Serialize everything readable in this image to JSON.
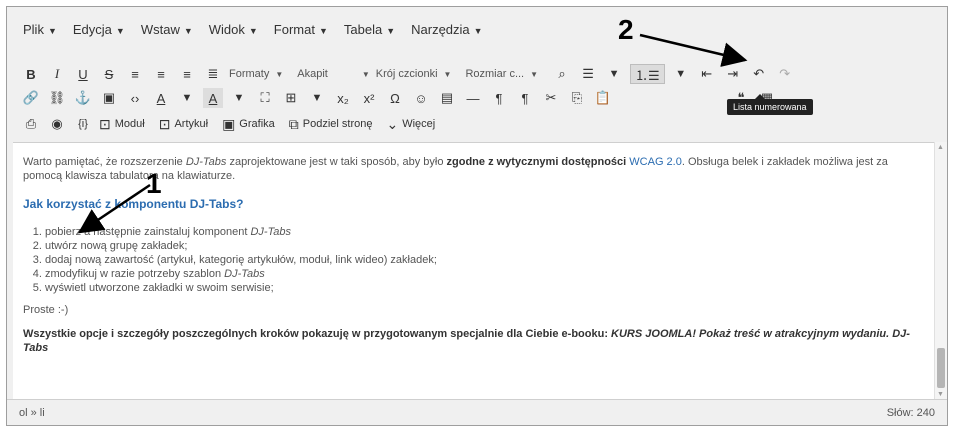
{
  "menubar": [
    {
      "label": "Plik"
    },
    {
      "label": "Edycja"
    },
    {
      "label": "Wstaw"
    },
    {
      "label": "Widok"
    },
    {
      "label": "Format"
    },
    {
      "label": "Tabela"
    },
    {
      "label": "Narzędzia"
    }
  ],
  "toolbar": {
    "row1": {
      "formats": "Formaty",
      "paragraph": "Akapit",
      "font": "Krój czcionki",
      "size": "Rozmiar c...",
      "tooltip": "Lista numerowana"
    },
    "row3": {
      "module": "Moduł",
      "article": "Artykuł",
      "image": "Grafika",
      "pagebreak": "Podziel stronę",
      "more": "Więcej"
    }
  },
  "content": {
    "intro_1": "Warto pamiętać, że rozszerzenie ",
    "intro_em": "DJ-Tabs",
    "intro_2": " zaprojektowane jest w taki sposób, aby było ",
    "intro_strong": "zgodne z wytycznymi dostępności",
    "intro_link": "WCAG 2.0",
    "intro_3": ". Obsługa belek i zakładek możliwa jest za pomocą klawisza tabulatora na klawiaturze.",
    "heading": "Jak korzystać z komponentu DJ-Tabs?",
    "steps": [
      {
        "text": "pobierz a następnie zainstaluj komponent ",
        "em": "DJ-Tabs"
      },
      {
        "text": "utwórz nową grupę zakładek;",
        "em": ""
      },
      {
        "text": "dodaj nową zawartość (artykuł, kategorię artykułów, moduł, link wideo) zakładek;",
        "em": ""
      },
      {
        "text": "zmodyfikuj w razie potrzeby szablon ",
        "em": "DJ-Tabs"
      },
      {
        "text": "wyświetl utworzone zakładki w swoim serwisie;",
        "em": ""
      }
    ],
    "simple": "Proste :-)",
    "bold_para_1": "Wszystkie opcje i szczegóły poszczególnych kroków pokazuję w przygotowanym specjalnie dla Ciebie e-booku: ",
    "bold_para_em": "KURS JOOMLA! Pokaż treść w atrakcyjnym wydaniu. DJ-Tabs"
  },
  "status": {
    "path": "ol » li",
    "wordcount": "Słów: 240"
  },
  "annotations": {
    "label_1": "1",
    "label_2": "2"
  }
}
